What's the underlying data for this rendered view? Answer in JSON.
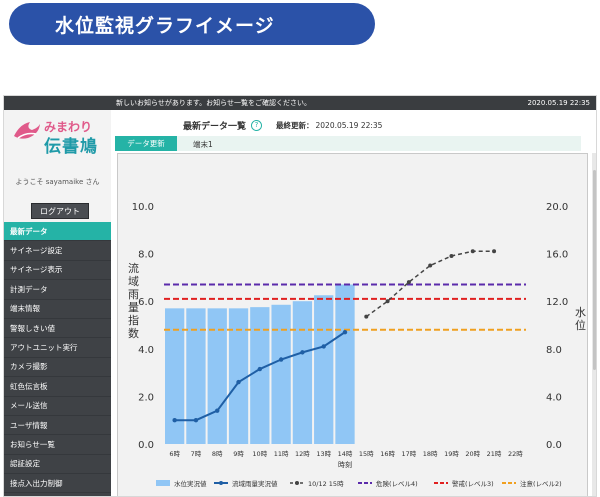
{
  "banner": {
    "title": "水位監視グラフイメージ"
  },
  "notice": {
    "text": "新しいお知らせがあります。お知らせ一覧をご確認ください。",
    "datetime": "2020.05.19 22:35"
  },
  "logo": {
    "top": "みまわり",
    "bottom": "伝書鳩"
  },
  "user": {
    "welcome": "ようこそ sayamaike さん",
    "logout_label": "ログアウト"
  },
  "menu": [
    {
      "label": "最新データ",
      "active": true
    },
    {
      "label": "サイネージ設定"
    },
    {
      "label": "サイネージ表示"
    },
    {
      "label": "計測データ"
    },
    {
      "label": "端末情報"
    },
    {
      "label": "警報しきい値"
    },
    {
      "label": "アウトユニット実行"
    },
    {
      "label": "カメラ撮影"
    },
    {
      "label": "虹色伝言板"
    },
    {
      "label": "メール送信"
    },
    {
      "label": "ユーザ情報"
    },
    {
      "label": "お知らせ一覧"
    },
    {
      "label": "認証設定"
    },
    {
      "label": "接点入出力制御"
    },
    {
      "label": "閲覧用アカウントの管理"
    }
  ],
  "header": {
    "title": "最新データ一覧",
    "help": "?",
    "updated_label": "最終更新：",
    "updated_value": "2020.05.19 22:35"
  },
  "tabs": {
    "active": "データ更新",
    "terminal": "端末1"
  },
  "colors": {
    "accent": "#25b3a6",
    "bar": "#90c6f5",
    "line": "#1f5fa5",
    "forecast": "#444444",
    "danger": "#5b2bab",
    "alert": "#e02020",
    "caution": "#f0a020"
  },
  "chart_data": {
    "type": "bar",
    "categories": [
      "6時",
      "7時",
      "8時",
      "9時",
      "10時",
      "11時",
      "12時",
      "13時",
      "14時",
      "15時",
      "16時",
      "17時",
      "18時",
      "19時",
      "20時",
      "21時",
      "22時"
    ],
    "xlabel": "時刻",
    "ylabel_left": "流域雨量指数",
    "ylabel_right": "水位",
    "ylim_left": [
      0,
      10
    ],
    "ylim_right": [
      0,
      20
    ],
    "yticks_left": [
      "0.0",
      "2.0",
      "4.0",
      "6.0",
      "8.0",
      "10.0"
    ],
    "yticks_right": [
      "0.0",
      "4.0",
      "8.0",
      "12.0",
      "16.0",
      "20.0"
    ],
    "series": [
      {
        "name": "水位実況値",
        "type": "bar",
        "axis": "left",
        "values": [
          5.7,
          5.7,
          5.7,
          5.7,
          5.75,
          5.85,
          6.0,
          6.25,
          6.7
        ]
      },
      {
        "name": "流域雨量実況値",
        "type": "line",
        "axis": "right",
        "values": [
          2.0,
          2.0,
          2.8,
          5.2,
          6.3,
          7.1,
          7.7,
          8.2,
          9.4
        ]
      },
      {
        "name": "10/12 15時",
        "type": "line",
        "dashed": true,
        "axis": "right",
        "offset": 9,
        "values": [
          10.7,
          12.0,
          13.6,
          15.0,
          15.8,
          16.2,
          16.2
        ]
      },
      {
        "name": "危険(レベル4)",
        "type": "hline",
        "axis": "left",
        "value": 6.7
      },
      {
        "name": "警戒(レベル3)",
        "type": "hline",
        "axis": "left",
        "value": 6.1
      },
      {
        "name": "注意(レベル2)",
        "type": "hline",
        "axis": "left",
        "value": 4.8
      }
    ],
    "legend_position": "bottom"
  }
}
